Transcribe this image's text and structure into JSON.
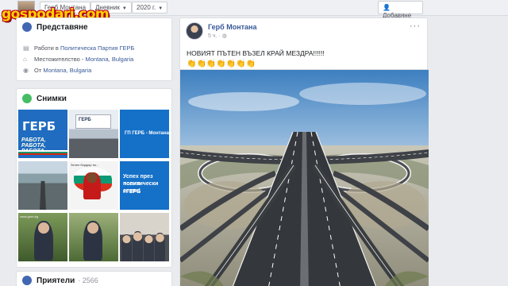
{
  "watermark": "gospodari.com",
  "topbar": {
    "page_name": "Герб Монтана",
    "tab_label": "Дневник",
    "year": "2020 г.",
    "add_button": "Добавяне"
  },
  "intro": {
    "title": "Представяне",
    "rows": [
      {
        "prefix": "Работи в ",
        "link": "Политическа Партия ГЕРБ",
        "suffix": ""
      },
      {
        "prefix": "Местожителство - ",
        "link": "Montana, Bulgaria",
        "suffix": ""
      },
      {
        "prefix": "От ",
        "link": "Montana, Bulgaria",
        "suffix": ""
      }
    ]
  },
  "photos": {
    "title": "Снимки",
    "thumbs": {
      "gerb_big": "ГЕРБ",
      "gerb_slogan": "РАБОТА, РАБОТА, РАБОТА",
      "meeting_sign": "ГЕРБ",
      "blue_caption": "ГП ГЕРБ - Монтана",
      "map_caption": "Зелен бордюр по...",
      "success_lines": [
        "Успех през новия",
        "политически сезон!",
        "#ГЕРБ"
      ],
      "speaker_caption": "www.gerb.bg"
    }
  },
  "friends": {
    "title": "Приятели",
    "count": "· 2566"
  },
  "post": {
    "author": "Герб Монтана",
    "time": "5 ч.",
    "text": "НОВИЯТ ПЪТЕН ВЪЗЕЛ КРАЙ МЕЗДРА!!!!!!",
    "emoji": "👏👏👏👏👏👏👏"
  },
  "colors": {
    "link": "#385898",
    "gerb_blue": "#1f6cc0",
    "page_bg": "#e9ebee",
    "watermark_fill": "#ffd400",
    "watermark_outline": "#c0001a"
  }
}
